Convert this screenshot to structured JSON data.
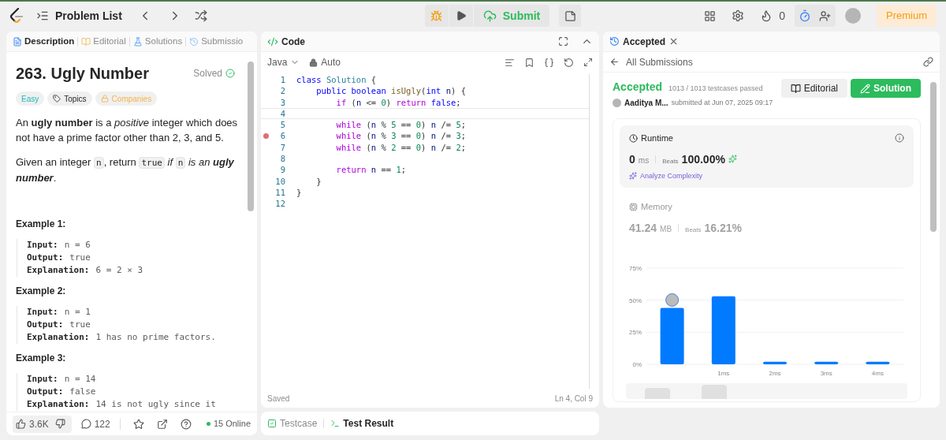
{
  "topbar": {
    "problem_list": "Problem List",
    "submit": "Submit",
    "streak": "0",
    "premium": "Premium"
  },
  "description_panel": {
    "tabs": [
      {
        "label": "Description",
        "selected": true
      },
      {
        "label": "Editorial",
        "selected": false
      },
      {
        "label": "Solutions",
        "selected": false
      },
      {
        "label": "Submissio",
        "selected": false
      }
    ],
    "title": "263. Ugly Number",
    "status": "Solved",
    "tags": [
      {
        "label": "Easy",
        "kind": "difficulty"
      },
      {
        "label": "Topics",
        "kind": "topics"
      },
      {
        "label": "Companies",
        "kind": "locked"
      }
    ],
    "paragraphs": [
      [
        {
          "text": "An **ugly number** is a *positive* integer which does not have a prime factor other than 2, 3, and 5.",
          "kind": "text"
        }
      ],
      [
        {
          "text": "Given an integer ",
          "kind": "text"
        },
        {
          "text": "n",
          "kind": "code"
        },
        {
          "text": ", return ",
          "kind": "text"
        },
        {
          "text": "true",
          "kind": "code"
        },
        {
          "text": " *if* ",
          "kind": "text"
        },
        {
          "text": "n",
          "kind": "code"
        },
        {
          "text": " *is an* ",
          "kind": "text"
        },
        {
          "text": "ugly number",
          "kind": "bolditalic"
        },
        {
          "text": ".",
          "kind": "text"
        }
      ]
    ],
    "examples": [
      {
        "title": "Example 1:",
        "lines": [
          {
            "label": "Input:",
            "value": "n = 6"
          },
          {
            "label": "Output:",
            "value": "true"
          },
          {
            "label": "Explanation:",
            "value": "6 = 2 × 3"
          }
        ]
      },
      {
        "title": "Example 2:",
        "lines": [
          {
            "label": "Input:",
            "value": "n = 1"
          },
          {
            "label": "Output:",
            "value": "true"
          },
          {
            "label": "Explanation:",
            "value": "1 has no prime factors."
          }
        ]
      },
      {
        "title": "Example 3:",
        "lines": [
          {
            "label": "Input:",
            "value": "n = 14"
          },
          {
            "label": "Output:",
            "value": "false"
          },
          {
            "label": "Explanation:",
            "value": "14 is not ugly since it"
          }
        ]
      }
    ],
    "footer": {
      "likes": "3.6K",
      "comments": "122",
      "online": "15 Online"
    }
  },
  "code_panel": {
    "title": "Code",
    "language": "Java",
    "mode": "Auto",
    "lines": [
      {
        "number": "1",
        "breakpoint": false,
        "current": false,
        "tokens": [
          {
            "text": "class ",
            "kind": "keyword"
          },
          {
            "text": "Solution",
            "kind": "type"
          },
          {
            "text": " {",
            "kind": "plain"
          }
        ]
      },
      {
        "number": "2",
        "breakpoint": false,
        "current": false,
        "tokens": [
          {
            "text": "    public boolean ",
            "kind": "keyword"
          },
          {
            "text": "isUgly",
            "kind": "function"
          },
          {
            "text": "(",
            "kind": "plain"
          },
          {
            "text": "int ",
            "kind": "keyword"
          },
          {
            "text": "n",
            "kind": "variable"
          },
          {
            "text": ") {",
            "kind": "plain"
          }
        ]
      },
      {
        "number": "3",
        "breakpoint": false,
        "current": false,
        "tokens": [
          {
            "text": "        if",
            "kind": "control"
          },
          {
            "text": " (",
            "kind": "plain"
          },
          {
            "text": "n",
            "kind": "variable"
          },
          {
            "text": " <= ",
            "kind": "plain"
          },
          {
            "text": "0",
            "kind": "number"
          },
          {
            "text": ") ",
            "kind": "plain"
          },
          {
            "text": "return ",
            "kind": "control"
          },
          {
            "text": "false",
            "kind": "keyword"
          },
          {
            "text": ";",
            "kind": "plain"
          }
        ]
      },
      {
        "number": "4",
        "breakpoint": false,
        "current": true
      },
      {
        "number": "5",
        "breakpoint": false,
        "current": false,
        "tokens": [
          {
            "text": "        while",
            "kind": "control"
          },
          {
            "text": " (",
            "kind": "plain"
          },
          {
            "text": "n",
            "kind": "variable"
          },
          {
            "text": " % ",
            "kind": "plain"
          },
          {
            "text": "5",
            "kind": "number"
          },
          {
            "text": " == ",
            "kind": "plain"
          },
          {
            "text": "0",
            "kind": "number"
          },
          {
            "text": ") ",
            "kind": "plain"
          },
          {
            "text": "n",
            "kind": "variable"
          },
          {
            "text": " /= ",
            "kind": "plain"
          },
          {
            "text": "5",
            "kind": "number"
          },
          {
            "text": ";",
            "kind": "plain"
          }
        ]
      },
      {
        "number": "6",
        "breakpoint": true,
        "current": false,
        "tokens": [
          {
            "text": "        while",
            "kind": "control"
          },
          {
            "text": " (",
            "kind": "plain"
          },
          {
            "text": "n",
            "kind": "variable"
          },
          {
            "text": " % ",
            "kind": "plain"
          },
          {
            "text": "3",
            "kind": "number"
          },
          {
            "text": " == ",
            "kind": "plain"
          },
          {
            "text": "0",
            "kind": "number"
          },
          {
            "text": ") ",
            "kind": "plain"
          },
          {
            "text": "n",
            "kind": "variable"
          },
          {
            "text": " /= ",
            "kind": "plain"
          },
          {
            "text": "3",
            "kind": "number"
          },
          {
            "text": ";",
            "kind": "plain"
          }
        ]
      },
      {
        "number": "7",
        "breakpoint": false,
        "current": false,
        "tokens": [
          {
            "text": "        while",
            "kind": "control"
          },
          {
            "text": " (",
            "kind": "plain"
          },
          {
            "text": "n",
            "kind": "variable"
          },
          {
            "text": " % ",
            "kind": "plain"
          },
          {
            "text": "2",
            "kind": "number"
          },
          {
            "text": " == ",
            "kind": "plain"
          },
          {
            "text": "0",
            "kind": "number"
          },
          {
            "text": ") ",
            "kind": "plain"
          },
          {
            "text": "n",
            "kind": "variable"
          },
          {
            "text": " /= ",
            "kind": "plain"
          },
          {
            "text": "2",
            "kind": "number"
          },
          {
            "text": ";",
            "kind": "plain"
          }
        ]
      },
      {
        "number": "8",
        "breakpoint": false,
        "current": false
      },
      {
        "number": "9",
        "breakpoint": false,
        "current": false,
        "tokens": [
          {
            "text": "        return ",
            "kind": "control"
          },
          {
            "text": "n",
            "kind": "variable"
          },
          {
            "text": " == ",
            "kind": "plain"
          },
          {
            "text": "1",
            "kind": "number"
          },
          {
            "text": ";",
            "kind": "plain"
          }
        ]
      },
      {
        "number": "10",
        "breakpoint": false,
        "current": false,
        "tokens": [
          {
            "text": "    }",
            "kind": "plain"
          }
        ]
      },
      {
        "number": "11",
        "breakpoint": false,
        "current": false,
        "tokens": [
          {
            "text": "}",
            "kind": "plain"
          }
        ]
      },
      {
        "number": "12",
        "breakpoint": false,
        "current": false
      }
    ],
    "saved": "Saved",
    "cursor": "Ln 4, Col 9"
  },
  "test_tabs": [
    {
      "label": "Testcase",
      "selected": false
    },
    {
      "label": "Test Result",
      "selected": true
    }
  ],
  "result_panel": {
    "tab": "Accepted",
    "back": "All Submissions",
    "status": "Accepted",
    "passed": "1013 / 1013 testcases passed",
    "user": "Aaditya M...",
    "submitted": "submitted at Jun 07, 2025 09:17",
    "editorial": "Editorial",
    "solution": "Solution",
    "metrics": [
      {
        "kind": "runtime",
        "title": "Runtime",
        "value": "0",
        "unit": "ms",
        "beats_label": "Beats",
        "beats": "100.00%",
        "selected": true,
        "link": "Analyze Complexity"
      },
      {
        "kind": "memory",
        "title": "Memory",
        "value": "41.24",
        "unit": "MB",
        "beats_label": "Beats",
        "beats": "16.21%",
        "selected": false
      }
    ],
    "chart_data": {
      "type": "bar",
      "categories": [
        null,
        "1ms",
        "2ms",
        "3ms",
        "4ms"
      ],
      "series": [
        {
          "color": "#007aff",
          "values": [
            44,
            53,
            2,
            2,
            2
          ]
        }
      ],
      "ylim": [
        0,
        75
      ],
      "yticks": [
        {
          "value": 0,
          "label": "0%"
        },
        {
          "value": 25,
          "label": "25%"
        },
        {
          "value": 50,
          "label": "50%"
        },
        {
          "value": 75,
          "label": "75%"
        }
      ]
    }
  }
}
